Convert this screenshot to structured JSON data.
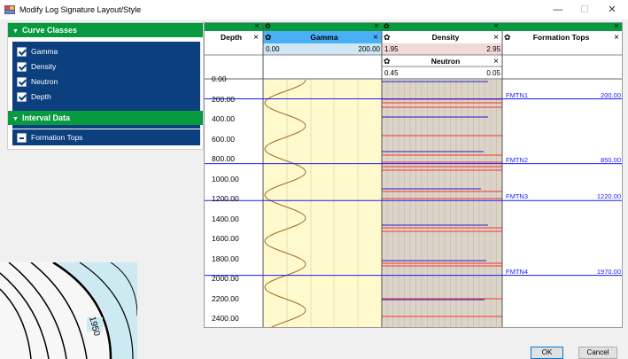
{
  "window": {
    "title": "Modify Log Signature Layout/Style",
    "minimize": "—",
    "maximize": "☐",
    "close": "✕"
  },
  "curve_classes": {
    "header": "Curve Classes",
    "items": [
      {
        "label": "Gamma",
        "checked": true
      },
      {
        "label": "Density",
        "checked": true
      },
      {
        "label": "Neutron",
        "checked": true
      },
      {
        "label": "Depth",
        "checked": true
      }
    ]
  },
  "interval_data": {
    "header": "Interval Data",
    "items": [
      {
        "label": "Formation Tops",
        "checked": "partial"
      }
    ]
  },
  "map_photo": {
    "contour_label": "1950"
  },
  "tracks": {
    "depth": {
      "title": "Depth",
      "close": "×"
    },
    "gamma": {
      "title": "Gamma",
      "close": "×",
      "min": "0.00",
      "max": "200.00",
      "fill_color": "#fffacd",
      "header_color": "#49b0f5",
      "curve_color": "#a06a2a"
    },
    "density": {
      "title": "Density",
      "close": "×",
      "min": "1.95",
      "max": "2.95",
      "fill_color": "#dcd4c8",
      "header_color": "#ffffff",
      "curve_color": "#ff0000"
    },
    "neutron": {
      "title": "Neutron",
      "close": "×",
      "min": "0.45",
      "max": "0.05",
      "curve_color": "#2020c0"
    },
    "formation_tops": {
      "title": "Formation Tops",
      "close": "×",
      "line_color": "#1a1aff"
    },
    "header_band_color": "#079a3f"
  },
  "depth_labels": [
    "0.00",
    "200.00",
    "400.00",
    "600.00",
    "800.00",
    "1000.00",
    "1200.00",
    "1400.00",
    "1600.00",
    "1800.00",
    "2000.00",
    "2200.00",
    "2400.00"
  ],
  "formation_tops": [
    {
      "name": "FMTN1",
      "depth": "200.00"
    },
    {
      "name": "FMTN2",
      "depth": "850.00"
    },
    {
      "name": "FMTN3",
      "depth": "1220.00"
    },
    {
      "name": "FMTN4",
      "depth": "1970.00"
    }
  ],
  "buttons": {
    "ok": "OK",
    "cancel": "Cancel"
  }
}
